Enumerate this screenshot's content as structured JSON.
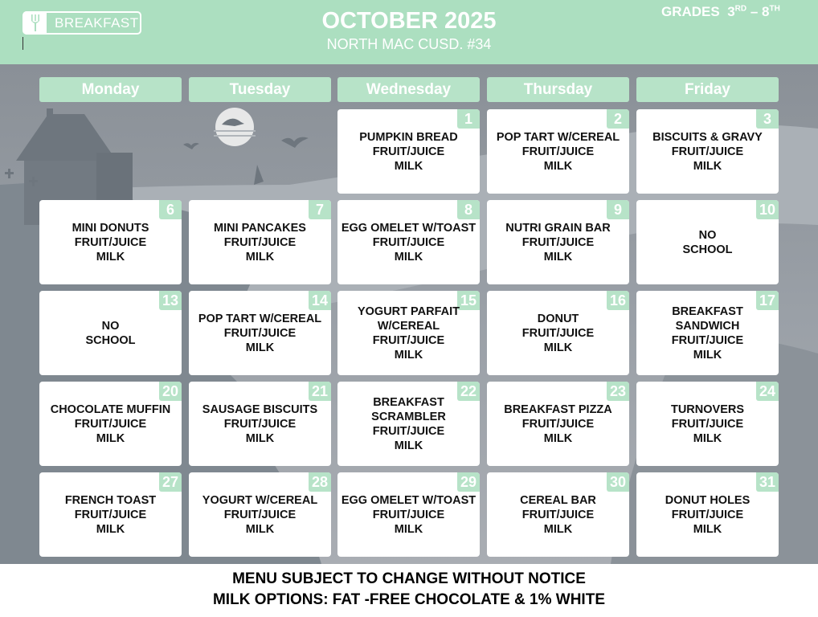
{
  "header": {
    "logo_text": "BREAKFAST",
    "title": "OCTOBER 2025",
    "subtitle": "NORTH MAC CUSD. #34",
    "grades_prefix": "GRADES",
    "grade_from": "3",
    "grade_from_suffix": "RD",
    "grade_sep": "–",
    "grade_to": "8",
    "grade_to_suffix": "TH"
  },
  "days": [
    "Monday",
    "Tuesday",
    "Wednesday",
    "Thursday",
    "Friday"
  ],
  "calendar": [
    {
      "date": "1",
      "lines": [
        "PUMPKIN BREAD",
        "FRUIT/JUICE",
        "MILK"
      ]
    },
    {
      "date": "2",
      "lines": [
        "POP TART W/CEREAL",
        "FRUIT/JUICE",
        "MILK"
      ]
    },
    {
      "date": "3",
      "lines": [
        "BISCUITS & GRAVY",
        "FRUIT/JUICE",
        "MILK"
      ]
    },
    {
      "date": "6",
      "lines": [
        "MINI DONUTS",
        "FRUIT/JUICE",
        "MILK"
      ]
    },
    {
      "date": "7",
      "lines": [
        "MINI PANCAKES",
        "FRUIT/JUICE",
        "MILK"
      ]
    },
    {
      "date": "8",
      "lines": [
        "EGG OMELET W/TOAST",
        "FRUIT/JUICE",
        "MILK"
      ]
    },
    {
      "date": "9",
      "lines": [
        "NUTRI GRAIN BAR",
        "FRUIT/JUICE",
        "MILK"
      ]
    },
    {
      "date": "10",
      "lines": [
        "NO",
        "SCHOOL"
      ]
    },
    {
      "date": "13",
      "lines": [
        "NO",
        "SCHOOL"
      ]
    },
    {
      "date": "14",
      "lines": [
        "POP TART W/CEREAL",
        "FRUIT/JUICE",
        "MILK"
      ]
    },
    {
      "date": "15",
      "lines": [
        "YOGURT PARFAIT",
        "W/CEREAL",
        "FRUIT/JUICE",
        "MILK"
      ]
    },
    {
      "date": "16",
      "lines": [
        "DONUT",
        "FRUIT/JUICE",
        "MILK"
      ]
    },
    {
      "date": "17",
      "lines": [
        "BREAKFAST",
        "SANDWICH",
        "FRUIT/JUICE",
        "MILK"
      ]
    },
    {
      "date": "20",
      "lines": [
        "CHOCOLATE MUFFIN",
        "FRUIT/JUICE",
        "MILK"
      ]
    },
    {
      "date": "21",
      "lines": [
        "SAUSAGE BISCUITS",
        "FRUIT/JUICE",
        "MILK"
      ]
    },
    {
      "date": "22",
      "lines": [
        "BREAKFAST",
        "SCRAMBLER",
        "FRUIT/JUICE",
        "MILK"
      ]
    },
    {
      "date": "23",
      "lines": [
        "BREAKFAST PIZZA",
        "FRUIT/JUICE",
        "MILK"
      ]
    },
    {
      "date": "24",
      "lines": [
        "TURNOVERS",
        "FRUIT/JUICE",
        "MILK"
      ]
    },
    {
      "date": "27",
      "lines": [
        "FRENCH TOAST",
        "FRUIT/JUICE",
        "MILK"
      ]
    },
    {
      "date": "28",
      "lines": [
        "YOGURT W/CEREAL",
        "FRUIT/JUICE",
        "MILK"
      ]
    },
    {
      "date": "29",
      "lines": [
        "EGG OMELET W/TOAST",
        "FRUIT/JUICE",
        "MILK"
      ]
    },
    {
      "date": "30",
      "lines": [
        "CEREAL BAR",
        "FRUIT/JUICE",
        "MILK"
      ]
    },
    {
      "date": "31",
      "lines": [
        "DONUT HOLES",
        "FRUIT/JUICE",
        "MILK"
      ]
    }
  ],
  "footer": {
    "line1": "MENU SUBJECT TO CHANGE WITHOUT NOTICE",
    "line2": "MILK OPTIONS: FAT -FREE CHOCOLATE & 1% WHITE"
  },
  "colors": {
    "header_green": "#acdfc0",
    "accent_green": "#b7e3c8",
    "background_gray": "#9aa1a8"
  },
  "icons": {
    "logo": "fork-icon",
    "background": "haunted-house-illustration"
  }
}
